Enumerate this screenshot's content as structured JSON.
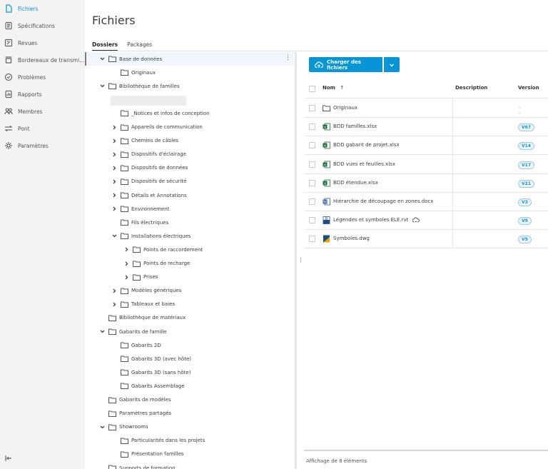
{
  "sidebar": {
    "items": [
      {
        "label": "Fichiers",
        "icon": "file-icon"
      },
      {
        "label": "Spécifications",
        "icon": "specs-icon"
      },
      {
        "label": "Revues",
        "icon": "review-icon"
      },
      {
        "label": "Bordereaux de transmi...",
        "icon": "transmittal-icon"
      },
      {
        "label": "Problèmes",
        "icon": "issues-icon"
      },
      {
        "label": "Rapports",
        "icon": "reports-icon"
      },
      {
        "label": "Membres",
        "icon": "members-icon"
      },
      {
        "label": "Pont",
        "icon": "bridge-icon"
      },
      {
        "label": "Paramètres",
        "icon": "settings-icon"
      }
    ],
    "collapse_icon": "collapse-icon"
  },
  "header": {
    "title": "Fichiers",
    "tabs": [
      "Dossiers",
      "Packages"
    ]
  },
  "tree": [
    {
      "label": "Base de données",
      "state": "expanded"
    },
    {
      "label": "Originaux",
      "state": "leaf"
    },
    {
      "label": "Bibliothèque de familles",
      "state": "expanded"
    },
    {
      "label": "",
      "state": "blurred"
    },
    {
      "label": "_Notices et infos de conception",
      "state": "leaf"
    },
    {
      "label": "Appareils de communication",
      "state": "collapsed"
    },
    {
      "label": "Chemins de câbles",
      "state": "collapsed"
    },
    {
      "label": "Dispositifs d'éclairage",
      "state": "collapsed"
    },
    {
      "label": "Dispositifs de données",
      "state": "collapsed"
    },
    {
      "label": "Dispositifs de sécurité",
      "state": "collapsed"
    },
    {
      "label": "Détails et Annotations",
      "state": "collapsed"
    },
    {
      "label": "Environnement",
      "state": "collapsed"
    },
    {
      "label": "Fils électriques",
      "state": "leaf"
    },
    {
      "label": "Installations électriques",
      "state": "expanded"
    },
    {
      "label": "Points de raccordement",
      "state": "collapsed"
    },
    {
      "label": "Points de recharge",
      "state": "collapsed"
    },
    {
      "label": "Prises",
      "state": "collapsed"
    },
    {
      "label": "Modèles génériques",
      "state": "collapsed"
    },
    {
      "label": "Tableaux et baies",
      "state": "collapsed"
    },
    {
      "label": "Bibliothèque de matériaux",
      "state": "leaf"
    },
    {
      "label": "Gabarits de famille",
      "state": "expanded"
    },
    {
      "label": "Gabarits 2D",
      "state": "leaf"
    },
    {
      "label": "Gabarits 3D (avec hôte)",
      "state": "leaf"
    },
    {
      "label": "Gabarits 3D (sans hôte)",
      "state": "leaf"
    },
    {
      "label": "Gabarits Assemblage",
      "state": "leaf"
    },
    {
      "label": "Gabarits de modèles",
      "state": "leaf"
    },
    {
      "label": "Paramètres partagés",
      "state": "leaf"
    },
    {
      "label": "Showrooms",
      "state": "expanded"
    },
    {
      "label": "Particularités dans les projets",
      "state": "leaf"
    },
    {
      "label": "Présentation familles",
      "state": "leaf"
    },
    {
      "label": "Supports de formation",
      "state": "leaf"
    }
  ],
  "toolbar": {
    "upload_label": "Charger des fichiers",
    "upload_icon": "cloud-upload-icon",
    "dropdown_icon": "chevron-down-icon"
  },
  "table": {
    "columns": {
      "name": "Nom",
      "sort_icon": "sort-up-arrow-icon",
      "description": "Description",
      "version": "Version"
    },
    "rows": [
      {
        "name": "Originaux",
        "type": "folder",
        "version": "--"
      },
      {
        "name": "BDD familles.xlsx",
        "type": "excel",
        "version": "V67"
      },
      {
        "name": "BDD gabarit de projet.xlsx",
        "type": "excel",
        "version": "V14"
      },
      {
        "name": "BDD vues et feuilles.xlsx",
        "type": "excel",
        "version": "V17"
      },
      {
        "name": "BDD étendue.xlsx",
        "type": "excel",
        "version": "V21"
      },
      {
        "name": "Hiérarchie de découpage en zones.docx",
        "type": "word",
        "version": "V3"
      },
      {
        "name": "Légendes et symboles ELE.rvt",
        "type": "revit",
        "version": "V9",
        "extra_icon": "link-cloud-icon"
      },
      {
        "name": "Symboles.dwg",
        "type": "dwg",
        "version": "V5"
      }
    ]
  },
  "footer": {
    "count_text": "Affichage de 8 éléments"
  },
  "colors": {
    "accent": "#0696d7",
    "sidebar_bg": "#f3f3f3"
  }
}
